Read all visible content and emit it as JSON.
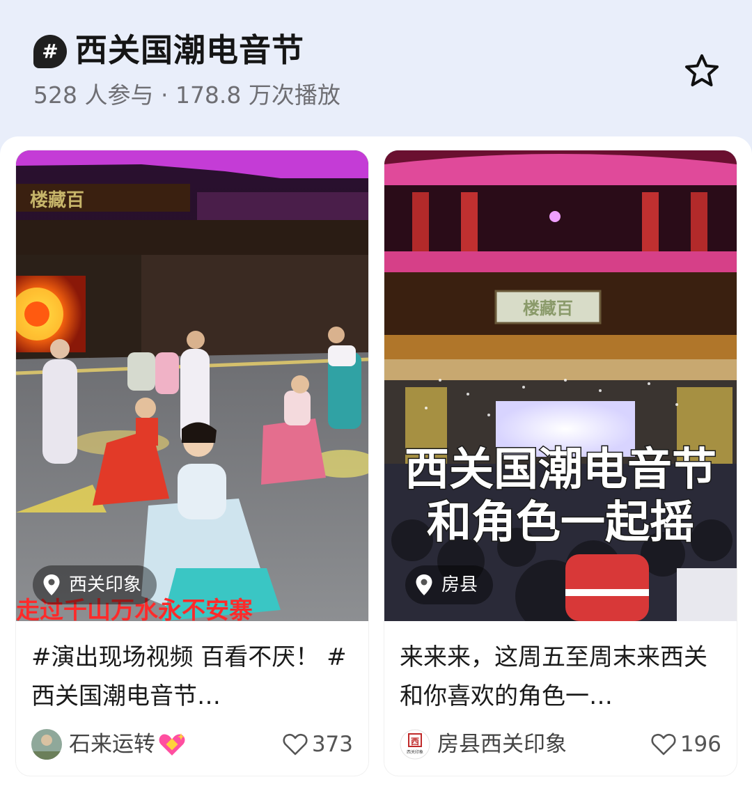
{
  "topic": {
    "badge": "#",
    "title": "西关国潮电音节",
    "stats": "528 人参与 · 178.8 万次播放"
  },
  "cards": [
    {
      "location": "西关印象",
      "caption": "#演出现场视频 百看不厌！ #西关国潮电音节…",
      "author": "石来运转",
      "likes": "373",
      "cover_sign": "楼藏百",
      "cover_subtitle": "走过千山万水永不安寨"
    },
    {
      "location": "房县",
      "caption": "来来来，这周五至周末来西关和你喜欢的角色一…",
      "author": "房县西关印象",
      "likes": "196",
      "avatar_text": "西",
      "avatar_caption": "西关印象",
      "overlay_line1": "西关国潮电音节",
      "overlay_line2": "和角色一起摇",
      "cover_sign": "楼藏百"
    }
  ],
  "colors": {
    "header_bg": "#e9eefa",
    "stage_purple": "#b13cff",
    "stage_red": "#b32a2a"
  }
}
